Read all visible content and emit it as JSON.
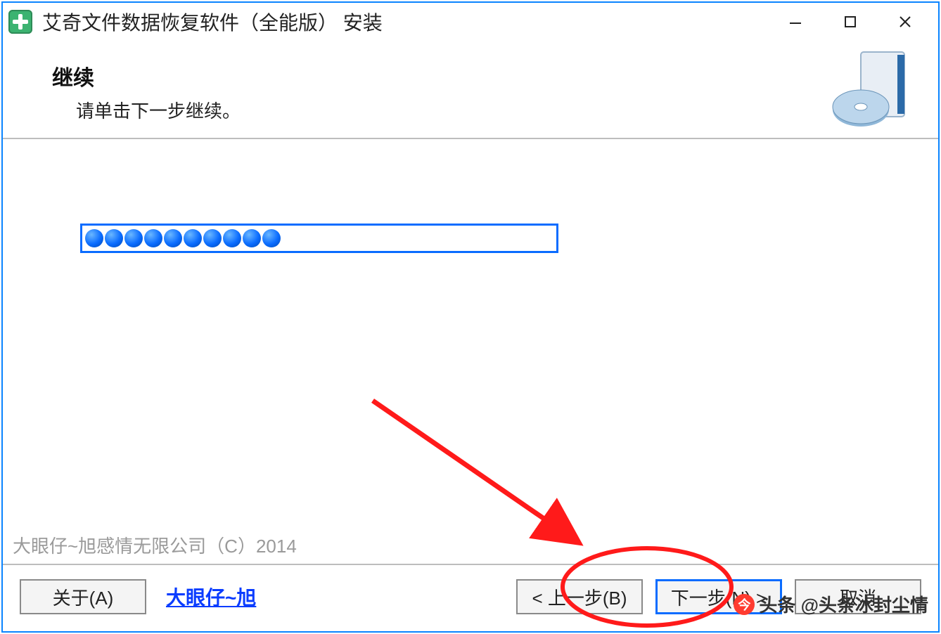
{
  "titlebar": {
    "title": "艾奇文件数据恢复软件（全能版） 安装"
  },
  "header": {
    "heading": "继续",
    "subtext": "请单击下一步继续。"
  },
  "progress": {
    "dot_count": 10
  },
  "copyright": "大眼仔~旭感情无限公司（C）2014",
  "footer": {
    "about": "关于(A)",
    "link": "大眼仔~旭",
    "back": "< 上一步(B)",
    "next": "下一步(N) >",
    "cancel": "取消"
  },
  "watermark": "头条 @头条冰封尘情"
}
